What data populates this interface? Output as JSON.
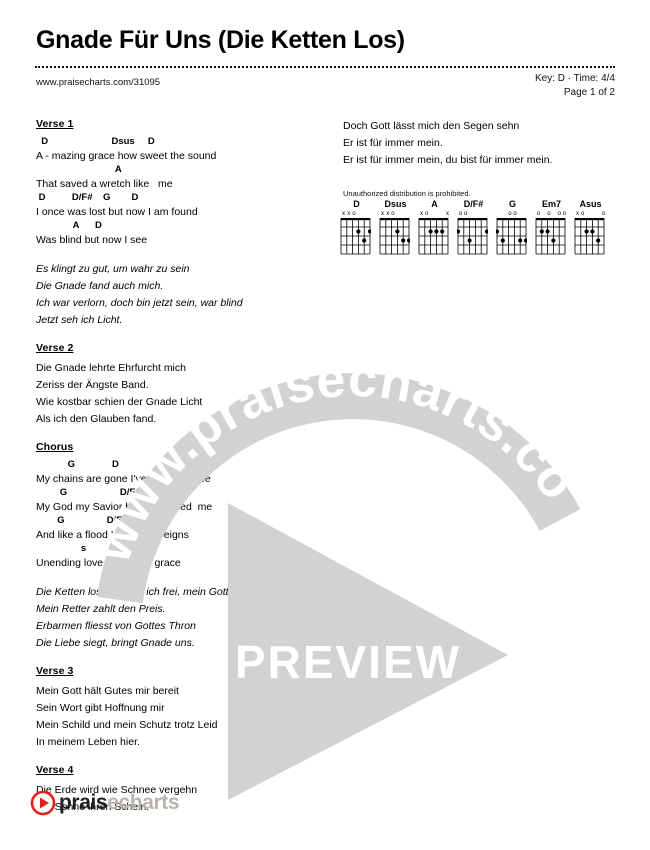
{
  "header": {
    "title": "Gnade Für Uns (Die Ketten Los)",
    "url": "www.praisecharts.com/31095",
    "key_time": "Key: D · Time: 4/4",
    "page": "Page 1 of 2"
  },
  "left_column": {
    "verse1_head": "Verse 1",
    "verse1": [
      {
        "chords": "  D                        Dsus     D",
        "lyric": "A - mazing grace how sweet the sound"
      },
      {
        "chords": "                              A",
        "lyric": "That saved a wretch like   me"
      },
      {
        "chords": " D          D/F#    G        D",
        "lyric": "I once was lost but now I am found"
      },
      {
        "chords": "              A      D",
        "lyric": "Was blind but now I see"
      }
    ],
    "verse1_german": [
      "Es klingt zu gut, um wahr zu sein",
      "Die Gnade fand auch mich.",
      "Ich war verlorn, doch bin jetzt sein, war blind",
      "Jetzt seh ich Licht."
    ],
    "verse2_head": "Verse 2",
    "verse2": [
      "Die Gnade lehrte Ehrfurcht mich",
      "Zeriss der Ängste Band.",
      "Wie kostbar schien der Gnade Licht",
      "Als ich den Glauben fand."
    ],
    "chorus_head": "Chorus",
    "chorus": [
      {
        "chords": "            G              D",
        "lyric": "My chains are gone I've been set free"
      },
      {
        "chords": "         G                    D/F#",
        "lyric": "My God my Savior has ransomed  me"
      },
      {
        "chords": "        G                D/F#",
        "lyric": "And like a flood His mercy reigns"
      },
      {
        "chords": "                 s          D",
        "lyric": "Unending love   amazing grace"
      }
    ],
    "chorus_german": [
      "Die Ketten los, jetzt bin ich frei, mein Gott",
      "Mein Retter zahlt den Preis.",
      "Erbarmen fliesst von Gottes Thron",
      "Die Liebe siegt, bringt Gnade uns."
    ],
    "verse3_head": "Verse 3",
    "verse3": [
      "Mein Gott hält Gutes mir bereit",
      "Sein Wort gibt Hoffnung mir",
      "Mein Schild und mein Schutz trotz Leid",
      "In meinem Leben hier."
    ],
    "verse4_head": "Verse 4",
    "verse4": [
      "Die Erde wird wie Schnee vergehn",
      "Die Sonne ihren Schein."
    ]
  },
  "right_column": {
    "lines": [
      "Doch Gott lässt mich den Segen sehn",
      "Er ist für immer mein.",
      "Er ist für immer mein, du bist für immer mein."
    ],
    "notice": "Unauthorized distribution is prohibited."
  },
  "chord_diagrams": [
    {
      "name": "D",
      "marks": [
        "x",
        "x",
        "o",
        "",
        "",
        ""
      ],
      "dots": [
        [
          2,
          3
        ],
        [
          3,
          2
        ],
        [
          2,
          1
        ]
      ]
    },
    {
      "name": "Dsus",
      "marks": [
        "x",
        "x",
        "o",
        "",
        "",
        ""
      ],
      "dots": [
        [
          2,
          3
        ],
        [
          3,
          2
        ],
        [
          3,
          1
        ]
      ]
    },
    {
      "name": "A",
      "marks": [
        "x",
        "o",
        "",
        "",
        "",
        "x"
      ],
      "dots": [
        [
          2,
          4
        ],
        [
          2,
          3
        ],
        [
          2,
          2
        ]
      ]
    },
    {
      "name": "D/F#",
      "marks": [
        "o",
        "o",
        "",
        "",
        "",
        ""
      ],
      "dots": [
        [
          2,
          6
        ],
        [
          3,
          4
        ],
        [
          2,
          1
        ]
      ]
    },
    {
      "name": "G",
      "marks": [
        "",
        "",
        "o",
        "o",
        "",
        ""
      ],
      "dots": [
        [
          2,
          6
        ],
        [
          3,
          5
        ],
        [
          3,
          2
        ],
        [
          3,
          1
        ]
      ]
    },
    {
      "name": "Em7",
      "marks": [
        "o",
        "",
        "o",
        "",
        "o",
        "o"
      ],
      "dots": [
        [
          2,
          5
        ],
        [
          2,
          4
        ],
        [
          3,
          3
        ]
      ]
    },
    {
      "name": "Asus",
      "marks": [
        "x",
        "o",
        "",
        "",
        "",
        "o"
      ],
      "dots": [
        [
          2,
          4
        ],
        [
          2,
          3
        ],
        [
          3,
          2
        ]
      ]
    }
  ],
  "watermark": {
    "arc_text": "www.praisecharts.com",
    "preview_text": "PREVIEW",
    "color": "#d2d2d2"
  },
  "footer": {
    "logo_dark": "prais",
    "logo_light": "echarts"
  }
}
